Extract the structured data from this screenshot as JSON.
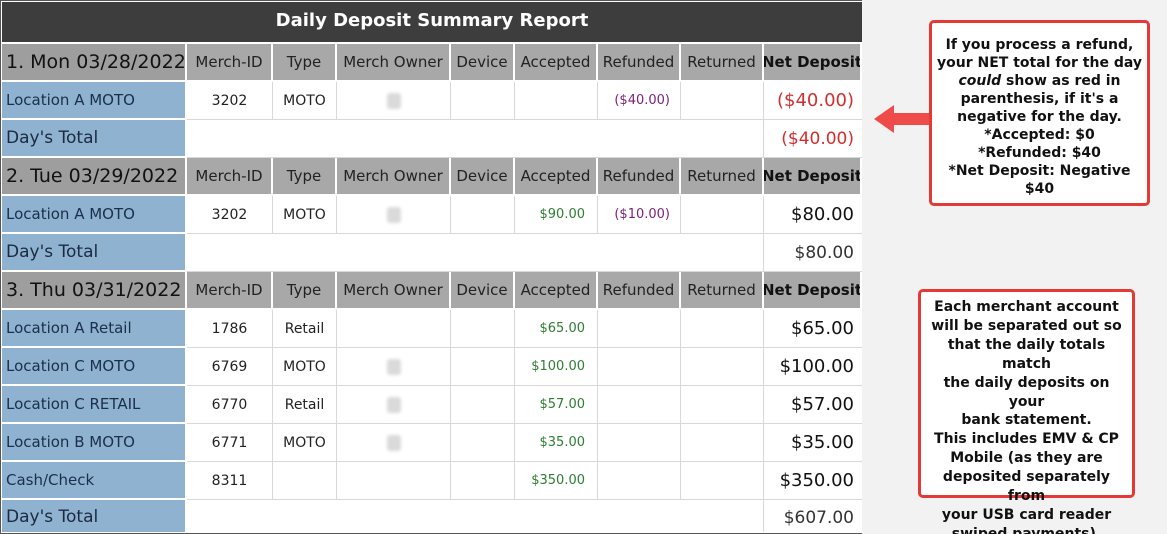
{
  "report": {
    "title": "Daily Deposit Summary Report",
    "columns": [
      "Merch-ID",
      "Type",
      "Merch Owner",
      "Device",
      "Accepted",
      "Refunded",
      "Returned",
      "Net Deposit"
    ],
    "total_label": "Day's Total",
    "days": [
      {
        "date": "1. Mon 03/28/2022",
        "rows": [
          {
            "location": "Location A MOTO",
            "merch_id": "3202",
            "type": "MOTO",
            "accepted": "",
            "refunded": "($40.00)",
            "returned": "",
            "net": "($40.00)"
          }
        ],
        "total": "($40.00)"
      },
      {
        "date": "2. Tue 03/29/2022",
        "rows": [
          {
            "location": "Location A MOTO",
            "merch_id": "3202",
            "type": "MOTO",
            "accepted": "$90.00",
            "refunded": "($10.00)",
            "returned": "",
            "net": "$80.00"
          }
        ],
        "total": "$80.00"
      },
      {
        "date": "3. Thu 03/31/2022",
        "rows": [
          {
            "location": "Location A Retail",
            "merch_id": "1786",
            "type": "Retail",
            "accepted": "$65.00",
            "refunded": "",
            "returned": "",
            "net": "$65.00"
          },
          {
            "location": "Location C MOTO",
            "merch_id": "6769",
            "type": "MOTO",
            "accepted": "$100.00",
            "refunded": "",
            "returned": "",
            "net": "$100.00"
          },
          {
            "location": "Location C RETAIL",
            "merch_id": "6770",
            "type": "Retail",
            "accepted": "$57.00",
            "refunded": "",
            "returned": "",
            "net": "$57.00"
          },
          {
            "location": "Location B MOTO",
            "merch_id": "6771",
            "type": "MOTO",
            "accepted": "$35.00",
            "refunded": "",
            "returned": "",
            "net": "$35.00"
          },
          {
            "location": "Cash/Check",
            "merch_id": "8311",
            "type": "",
            "accepted": "$350.00",
            "refunded": "",
            "returned": "",
            "net": "$350.00"
          }
        ],
        "total": "$607.00"
      }
    ]
  },
  "callout_refund": {
    "line1": "If you process a refund,",
    "line2": "your NET total for the day",
    "line3_italic": "could",
    "line3_rest": " show as red in",
    "line4": "parenthesis, if it's a",
    "line5": "negative for the day.",
    "line6": "*Accepted: $0",
    "line7": "*Refunded: $40",
    "line8": "*Net Deposit: Negative $40"
  },
  "callout_merchant": {
    "line1": "Each merchant account",
    "line2": "will be separated out so",
    "line3": "that the daily totals match",
    "line4": "the daily deposits on your",
    "line5": "bank statement.",
    "line6": "This includes EMV & CP",
    "line7": "Mobile (as they are",
    "line8": "deposited separately from",
    "line9": "your USB card reader",
    "line10": "swiped payments)."
  },
  "colors": {
    "title_bg": "#3d3d3d",
    "header_bg": "#a8a8a8",
    "location_bg": "#8fb2d0",
    "negative": "#d32f2f",
    "accepted": "#2e7d32",
    "refunded": "#7b1f7b",
    "callout_border": "#e53935"
  }
}
